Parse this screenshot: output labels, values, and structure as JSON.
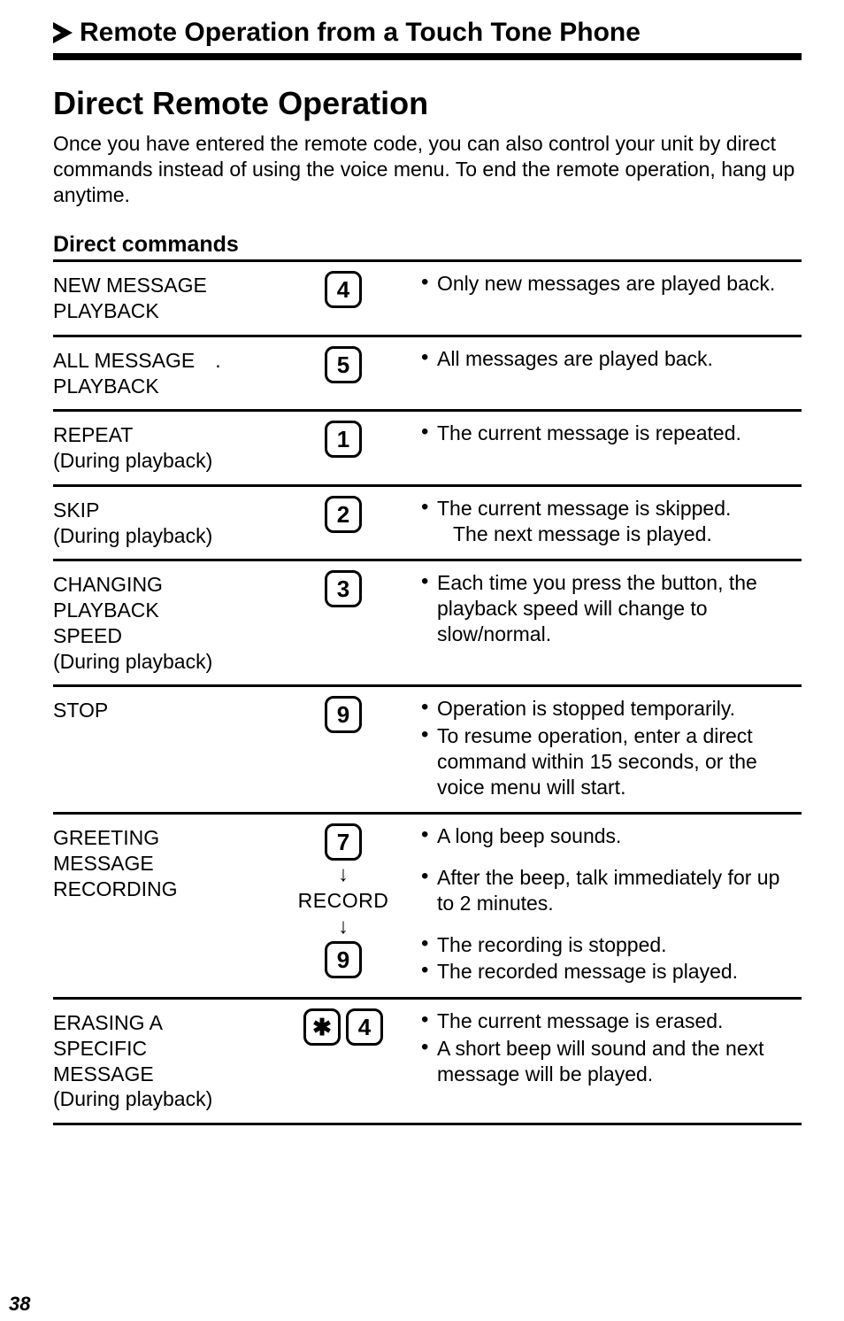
{
  "section_header": "Remote Operation from a Touch Tone Phone",
  "title": "Direct Remote Operation",
  "intro": "Once you have entered the remote code, you can also control your unit by direct commands instead of using the voice menu. To end the remote operation, hang up anytime.",
  "subheading": "Direct commands",
  "page_number": "38",
  "record_label": "RECORD",
  "commands": [
    {
      "name_line1": "NEW MESSAGE",
      "name_line2": "PLAYBACK",
      "keys": [
        "4"
      ],
      "desc": [
        {
          "bullets": [
            "Only new messages are played back."
          ]
        }
      ]
    },
    {
      "name_line1": "ALL MESSAGE",
      "name_line2": "PLAYBACK",
      "name_dot": ".",
      "keys": [
        "5"
      ],
      "desc": [
        {
          "bullets": [
            "All messages are played back."
          ]
        }
      ]
    },
    {
      "name_line1": "REPEAT",
      "name_line2": "(During playback)",
      "keys": [
        "1"
      ],
      "desc": [
        {
          "bullets": [
            "The current message is repeated."
          ]
        }
      ]
    },
    {
      "name_line1": "SKIP",
      "name_line2": "(During playback)",
      "keys": [
        "2"
      ],
      "desc": [
        {
          "bullets": [
            "The current message is skipped.",
            {
              "sub": "The next message is played."
            }
          ]
        }
      ]
    },
    {
      "name_line1": "CHANGING",
      "name_line2": "PLAYBACK",
      "name_line3": "SPEED",
      "name_line4": "(During playback)",
      "keys": [
        "3"
      ],
      "desc": [
        {
          "bullets": [
            "Each time you press the button, the playback speed will change to slow/normal."
          ]
        }
      ]
    },
    {
      "name_line1": "STOP",
      "keys": [
        "9"
      ],
      "desc": [
        {
          "bullets": [
            "Operation is stopped temporarily.",
            "To resume operation, enter a direct command within 15 seconds, or the voice menu will start."
          ]
        }
      ]
    },
    {
      "name_line1": "GREETING",
      "name_line2": "MESSAGE",
      "name_line3": "RECORDING",
      "sequence": true,
      "desc": [
        {
          "bullets": [
            "A long beep sounds."
          ]
        },
        {
          "bullets": [
            "After the beep, talk immediately for up to 2 minutes."
          ]
        },
        {
          "bullets": [
            "The recording is stopped.",
            "The recorded message is played."
          ]
        }
      ]
    },
    {
      "name_line1": "ERASING A",
      "name_line2": "SPECIFIC",
      "name_line3": "MESSAGE",
      "name_line4": "(During playback)",
      "keys_inline": [
        "✱",
        "4"
      ],
      "desc": [
        {
          "bullets": [
            "The current message is erased.",
            "A short beep will sound and the next message will be played."
          ]
        }
      ]
    }
  ]
}
